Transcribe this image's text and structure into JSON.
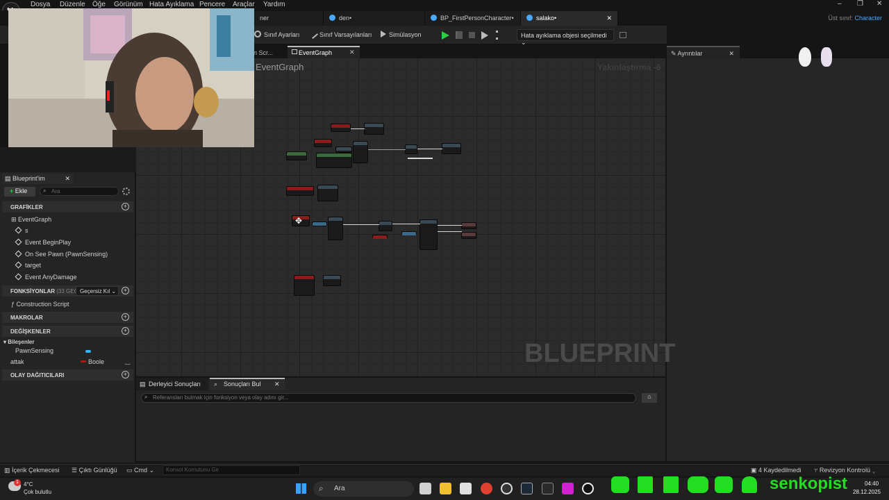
{
  "menu": [
    "Dosya",
    "Düzenle",
    "Öğe",
    "Görünüm",
    "Hata Ayıklama",
    "Pencere",
    "Araçlar",
    "Yardım"
  ],
  "window_controls": [
    "–",
    "❐",
    "✕"
  ],
  "doc_tabs": [
    {
      "label": "ner"
    },
    {
      "label": "den•"
    },
    {
      "label": "BP_FirstPersonCharacter•"
    },
    {
      "label": "salako•"
    }
  ],
  "tab_close": "✕",
  "parent_class": {
    "label": "Üst sınıf:",
    "value": "Character"
  },
  "toolbar": {
    "class_settings": "Sınıf Ayarları",
    "class_defaults": "Sınıf Varsayılanları",
    "simulation": "Simülasyon",
    "debug_object": "Hata ayıklama objesi seçilmedi"
  },
  "graph_tabs": {
    "construction": "on Scr...",
    "event_graph": "EventGraph"
  },
  "details_tab": "Ayrıntılar",
  "graph": {
    "title": "EventGraph",
    "zoom": "Yakınlaştırma -6",
    "watermark": "BLUEPRINT"
  },
  "left_panel": {
    "tab": "Blueprint'im",
    "add": "Ekle",
    "search_placeholder": "Ara",
    "sections": {
      "graphs": "GRAFİKLER",
      "functions": "FONKSİYONLAR",
      "functions_count": "(33 GEÇERSİ",
      "override": "Geçersiz Kıl",
      "macros": "MAKROLAR",
      "variables": "DEĞİŞKENLER",
      "dispatchers": "OLAY DAĞITICILARI"
    },
    "graph_items": [
      "EventGraph",
      "s",
      "Event BeginPlay",
      "On See Pawn (PawnSensing)",
      "target",
      "Event AnyDamage"
    ],
    "function_items": [
      "Construction Script"
    ],
    "components_label": "Bileşenler",
    "components": [
      "PawnSensing"
    ],
    "variables": [
      {
        "name": "attak",
        "type": "Boole",
        "color": "#b01818"
      }
    ]
  },
  "bottom_panel": {
    "tab_compiler": "Derleyici Sonuçları",
    "tab_find": "Sonuçları Bul",
    "find_placeholder": "Referansları bulmak için fonksiyon veya olay adını gir..."
  },
  "status_bar": {
    "content_drawer": "İçerik Çekmecesi",
    "output_log": "Çıktı Günlüğü",
    "cmd": "Cmd",
    "console_placeholder": "Konsol Komutunu Gir",
    "saved": "4 Kaydedilmedi",
    "revision": "Revizyon Kontrolü"
  },
  "taskbar": {
    "weather_temp": "4°C",
    "weather_desc": "Çok bulutlu",
    "weather_badge": "1",
    "search": "Ara",
    "time": "04:40",
    "date": "28.12.2025"
  },
  "overlay": {
    "channel": "senkopist"
  },
  "colors": {
    "accent": "#4aa8ff",
    "play": "#2ecc40",
    "social": "#22dd22",
    "event_node": "#8a1c1c"
  }
}
